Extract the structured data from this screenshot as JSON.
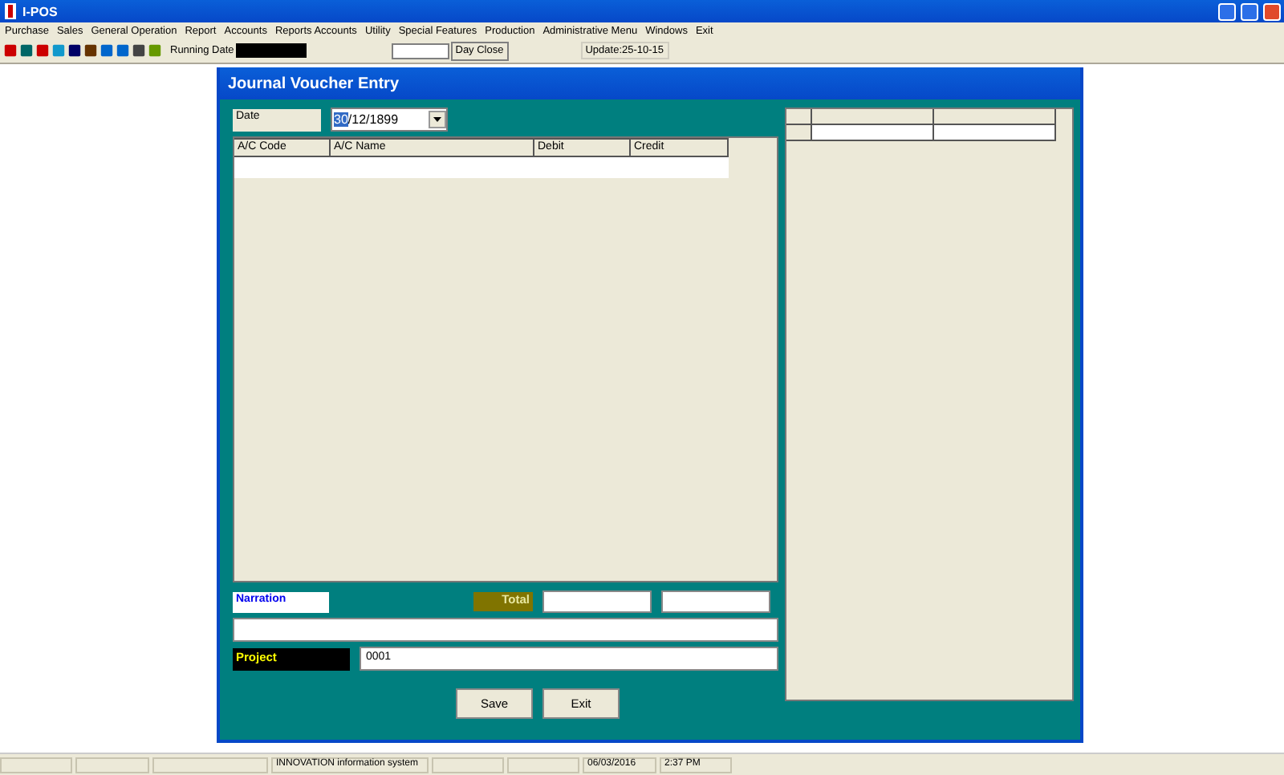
{
  "app": {
    "title": "I-POS"
  },
  "menu": [
    "Purchase",
    "Sales",
    "General Operation",
    "Report",
    "Accounts",
    "Reports Accounts",
    "Utility",
    "Special Features",
    "Production",
    "Administrative Menu",
    "Windows",
    "Exit"
  ],
  "toolbar": {
    "running_date_label": "Running Date",
    "day_close": "Day Close",
    "update": "Update:25-10-15"
  },
  "voucher": {
    "title": "Journal Voucher Entry",
    "date_label": "Date",
    "date_day": "30",
    "date_rest": "/12/1899",
    "day_selected": true,
    "columns": [
      "A/C Code",
      "A/C Name",
      "Debit",
      "Credit"
    ],
    "narration_label": "Narration",
    "total_label": "Total",
    "project_label": "Project",
    "project_value": "0001",
    "buttons": [
      "Save",
      "Exit"
    ]
  },
  "status_bar": {
    "company": "INNOVATION information system",
    "date": "06/03/2016",
    "time": "2:37 PM"
  }
}
